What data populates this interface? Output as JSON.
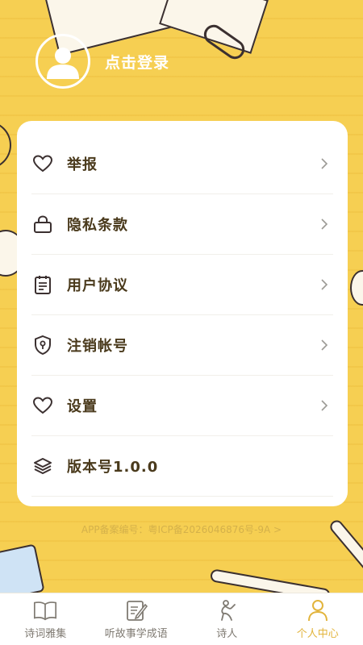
{
  "profile": {
    "login_label": "点击登录",
    "avatar_icon": "user-silhouette-icon"
  },
  "menu": {
    "items": [
      {
        "label": "举报",
        "icon": "heart-icon"
      },
      {
        "label": "隐私条款",
        "icon": "lock-icon"
      },
      {
        "label": "用户协议",
        "icon": "clipboard-icon"
      },
      {
        "label": "注销帐号",
        "icon": "shield-keyhole-icon"
      },
      {
        "label": "设置",
        "icon": "heart-icon"
      },
      {
        "label": "版本号1.0.0",
        "icon": "layers-icon"
      }
    ]
  },
  "footer": {
    "icp_text": "APP备案编号：粤ICP备2026046876号-9A >"
  },
  "tabbar": {
    "tabs": [
      {
        "label": "诗词雅集",
        "icon": "book-icon",
        "active": false
      },
      {
        "label": "听故事学成语",
        "icon": "notepad-pen-icon",
        "active": false
      },
      {
        "label": "诗人",
        "icon": "poet-figure-icon",
        "active": false
      },
      {
        "label": "个人中心",
        "icon": "person-icon",
        "active": true
      }
    ]
  },
  "colors": {
    "background": "#f6cf52",
    "card": "#ffffff",
    "text": "#4a3a1c",
    "active_tab": "#e2b43c",
    "inactive_tab": "#7f7a72"
  }
}
